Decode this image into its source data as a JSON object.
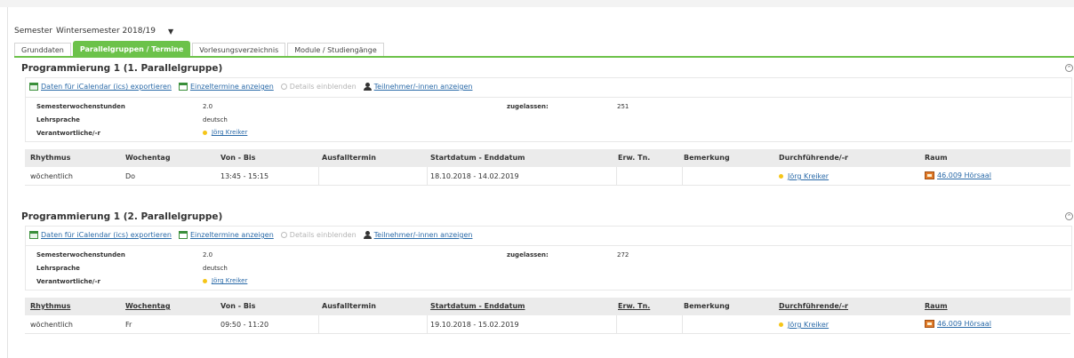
{
  "semester": {
    "label": "Semester",
    "value": "Wintersemester 2018/19"
  },
  "tabs": [
    {
      "label": "Grunddaten"
    },
    {
      "label": "Parallelgruppen / Termine"
    },
    {
      "label": "Vorlesungsverzeichnis"
    },
    {
      "label": "Module / Studiengänge"
    }
  ],
  "active_tab": "Parallelgruppen / Termine",
  "accent_color": "#6cc24a",
  "link_color": "#2a6aa8",
  "actions": {
    "export_ics": "Daten für iCalendar (ics) exportieren",
    "show_single_dates": "Einzeltermine anzeigen",
    "show_details": "Details einblenden",
    "show_participants": "Teilnehmer/-innen anzeigen"
  },
  "labels": {
    "sws": "Semesterwochenstunden",
    "language": "Lehrsprache",
    "responsible": "Verantwortliche/-r",
    "admitted": "zugelassen:"
  },
  "table_headers": [
    "Rhythmus",
    "Wochentag",
    "Von - Bis",
    "Ausfalltermin",
    "Startdatum - Enddatum",
    "Erw. Tn.",
    "Bemerkung",
    "Durchführende/-r",
    "Raum"
  ],
  "groups": [
    {
      "title": "Programmierung 1 (1. Parallelgruppe)",
      "sws": "2.0",
      "language": "deutsch",
      "responsible": "Jörg Kreiker",
      "admitted": "251",
      "row": {
        "rhythm": "wöchentlich",
        "weekday": "Do",
        "time": "13:45 - 15:15",
        "cancel": "",
        "dates": "18.10.2018 - 14.02.2019",
        "expected": "",
        "remark": "",
        "lecturer": "Jörg Kreiker",
        "room": "46.009 Hörsaal"
      }
    },
    {
      "title": "Programmierung 1 (2. Parallelgruppe)",
      "sws": "2.0",
      "language": "deutsch",
      "responsible": "Jörg Kreiker",
      "admitted": "272",
      "row": {
        "rhythm": "wöchentlich",
        "weekday": "Fr",
        "time": "09:50 - 11:20",
        "cancel": "",
        "dates": "19.10.2018 - 15.02.2019",
        "expected": "",
        "remark": "",
        "lecturer": "Jörg Kreiker",
        "room": "46.009 Hörsaal"
      }
    }
  ]
}
